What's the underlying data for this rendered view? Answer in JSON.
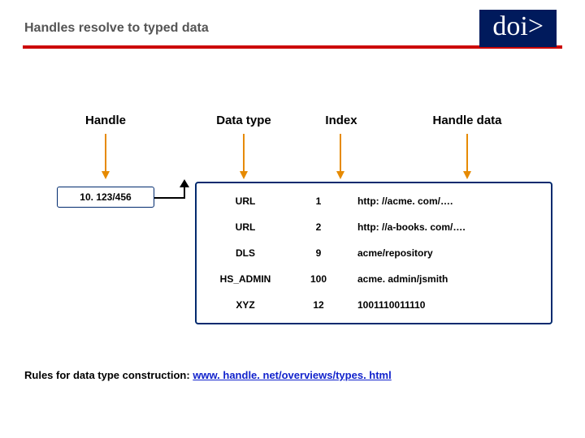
{
  "header": {
    "title": "Handles resolve to typed data",
    "badge": "doi>"
  },
  "columns": {
    "handle": "Handle",
    "datatype": "Data type",
    "index": "Index",
    "handledata": "Handle data"
  },
  "handle_id": "10. 123/456",
  "rows": [
    {
      "datatype": "URL",
      "index": "1",
      "value": "http: //acme. com/…."
    },
    {
      "datatype": "URL",
      "index": "2",
      "value": "http: //a-books. com/…."
    },
    {
      "datatype": "DLS",
      "index": "9",
      "value": "acme/repository"
    },
    {
      "datatype": "HS_ADMIN",
      "index": "100",
      "value": "acme. admin/jsmith"
    },
    {
      "datatype": "XYZ",
      "index": "12",
      "value": "1001110011110"
    }
  ],
  "footer": {
    "prefix": "Rules for data type construction: ",
    "link_text": "www. handle. net/overviews/types. html"
  }
}
